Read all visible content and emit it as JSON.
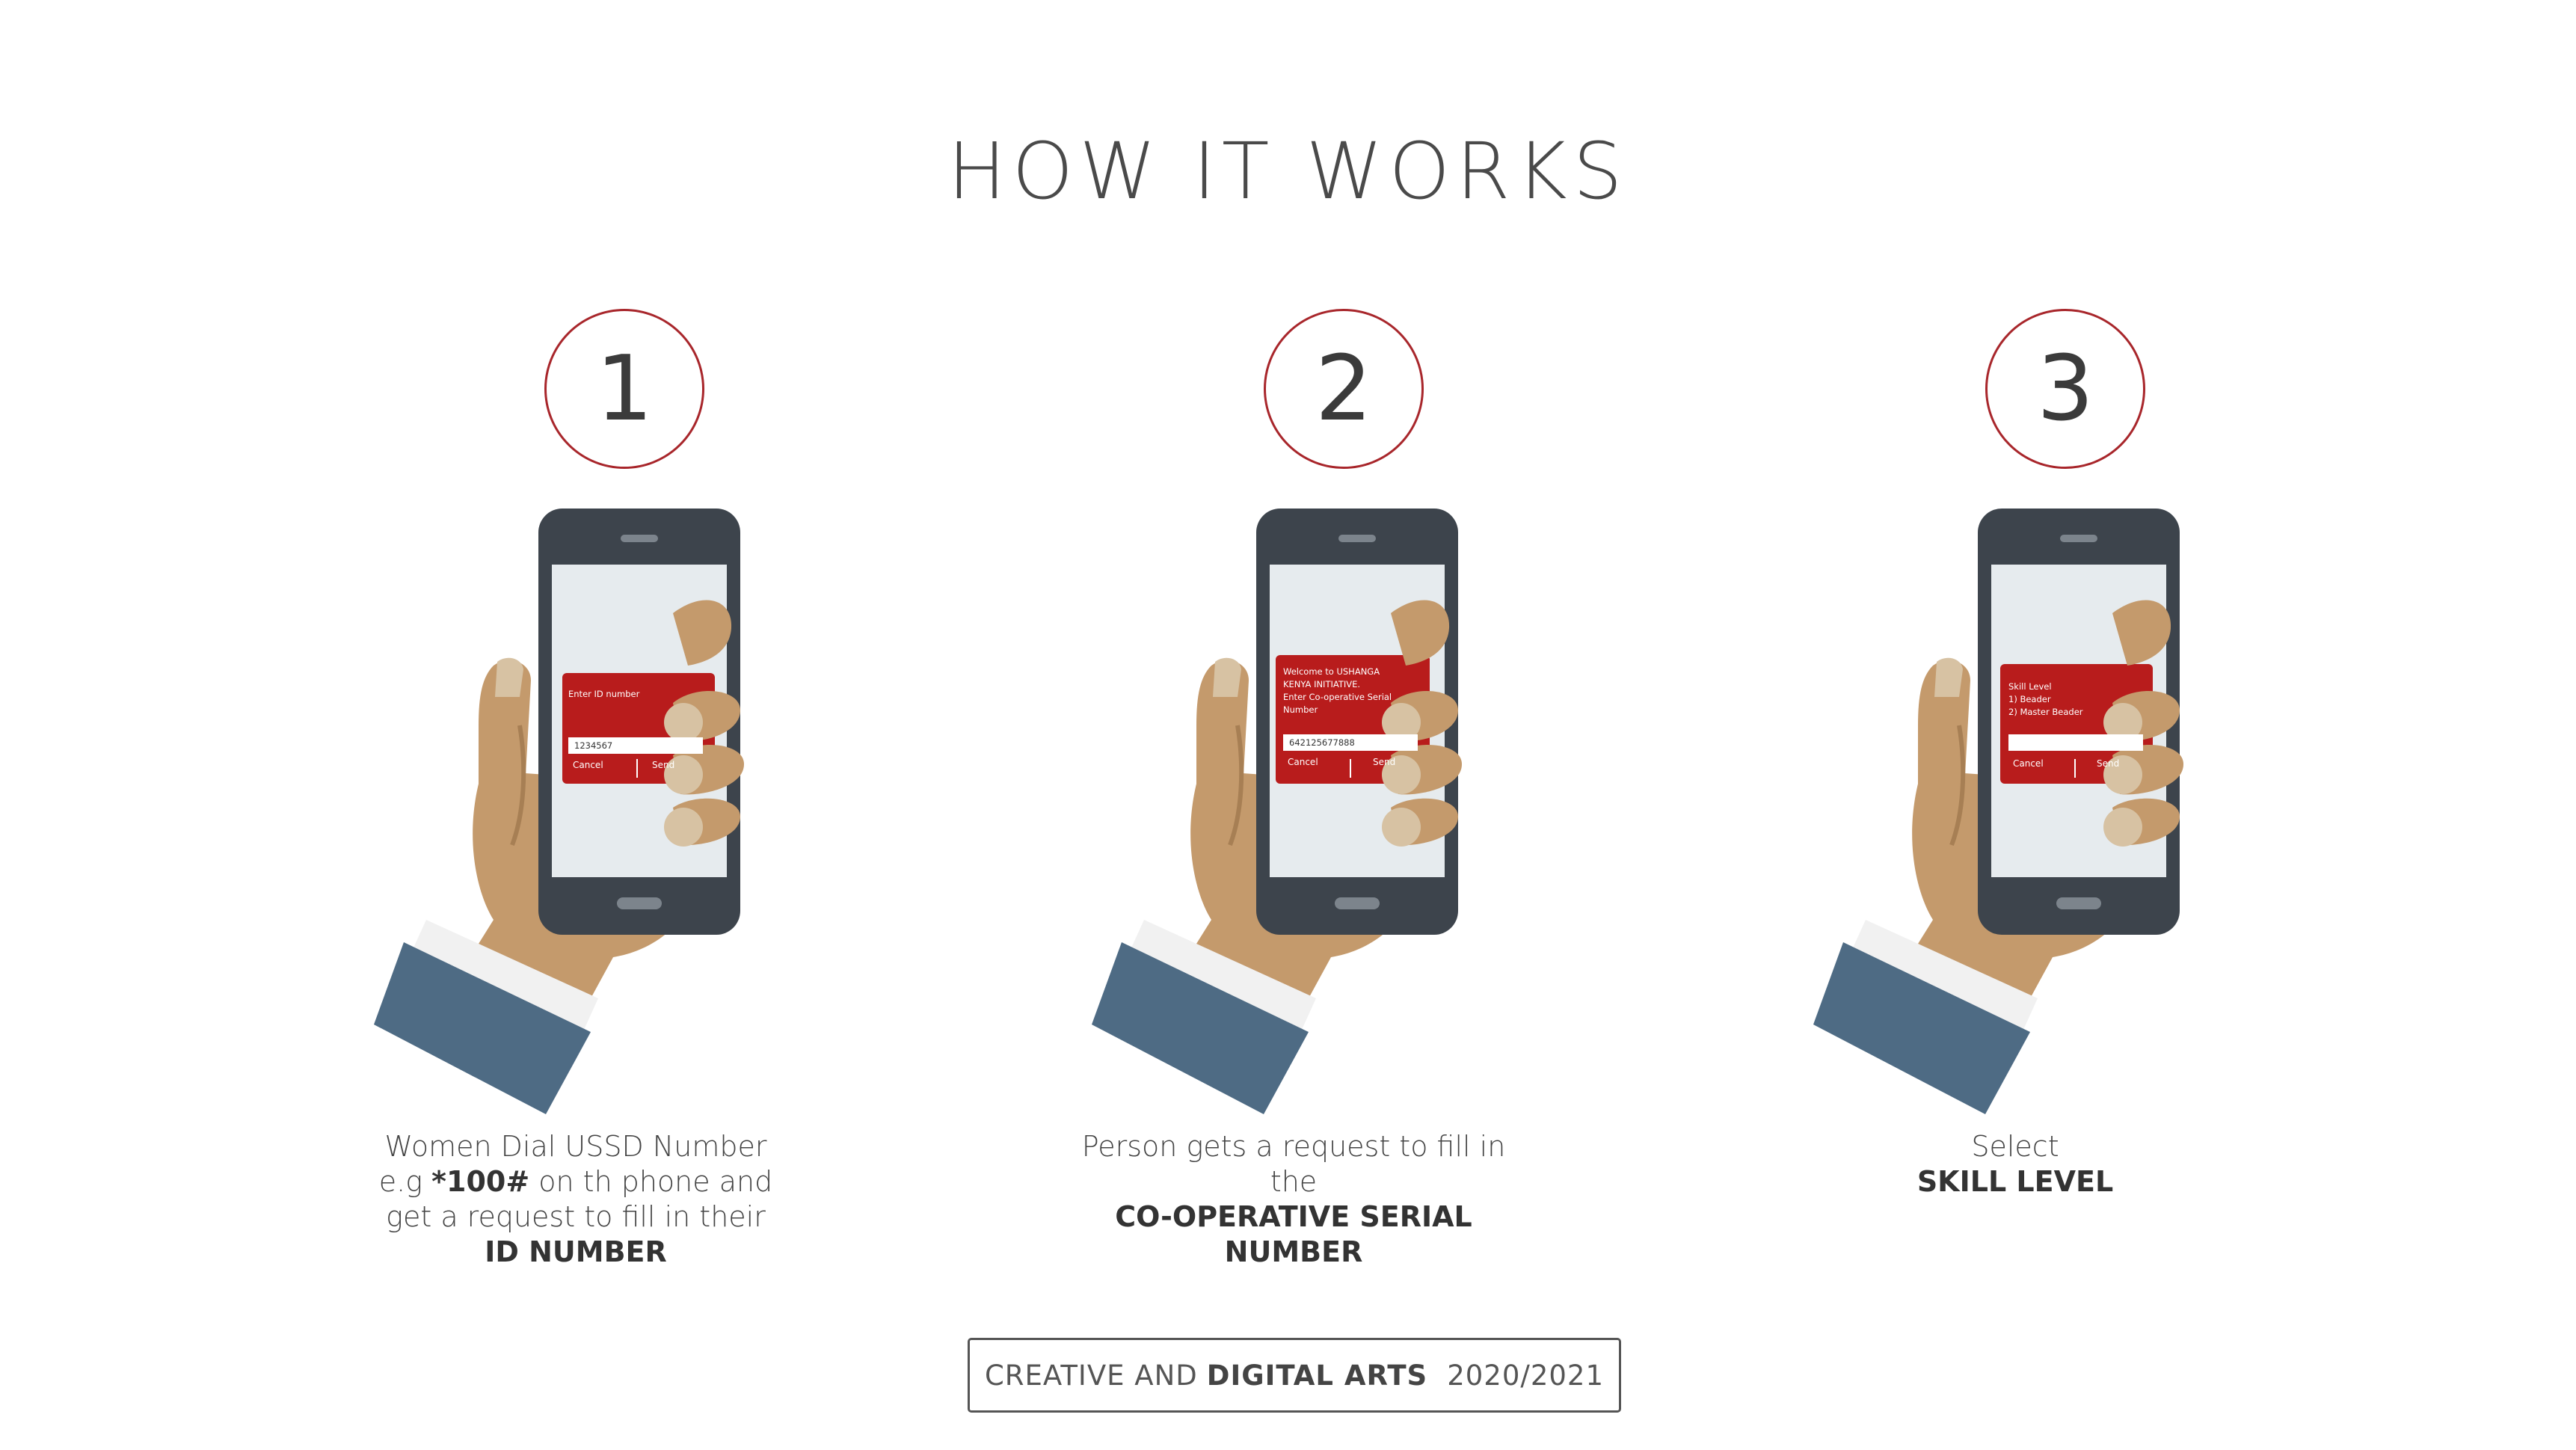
{
  "page": {
    "title": "HOW IT WORKS"
  },
  "colors": {
    "accent_red": "#a8262b",
    "screen_red": "#b81c1c",
    "phone_body": "#3d444c",
    "screen_bg": "#e6ebee",
    "skin": "#c49a6c",
    "sleeve": "#4e6b84",
    "cuff": "#f1f1f1"
  },
  "steps": [
    {
      "number": "1",
      "screen": {
        "prompt": "Enter ID number",
        "input_value": "1234567",
        "cancel_label": "Cancel",
        "send_label": "Send"
      },
      "description": {
        "line1": "Women Dial USSD Number",
        "line2_prefix": "e.g ",
        "code": "*100#",
        "line2_suffix": " on th phone and",
        "line3": "get a request  to fill in their",
        "bold": "ID NUMBER"
      }
    },
    {
      "number": "2",
      "screen": {
        "prompt": "Welcome to USHANGA\nKENYA INITIATIVE.\nEnter Co-operative Serial\nNumber",
        "input_value": "642125677888",
        "cancel_label": "Cancel",
        "send_label": "Send"
      },
      "description": {
        "line1": "Person gets a request to fill in",
        "line2": "the",
        "bold1": "CO-OPERATIVE SERIAL",
        "bold2": "NUMBER"
      }
    },
    {
      "number": "3",
      "screen": {
        "prompt": "Skill Level\n1) Beader\n2) Master Beader",
        "input_value": "",
        "cancel_label": "Cancel",
        "send_label": "Send"
      },
      "description": {
        "line1": "Select",
        "bold": "SKILL LEVEL"
      }
    }
  ],
  "footer": {
    "prefix": "CREATIVE AND",
    "bold": "DIGITAL ARTS",
    "year": "2020/2021"
  }
}
